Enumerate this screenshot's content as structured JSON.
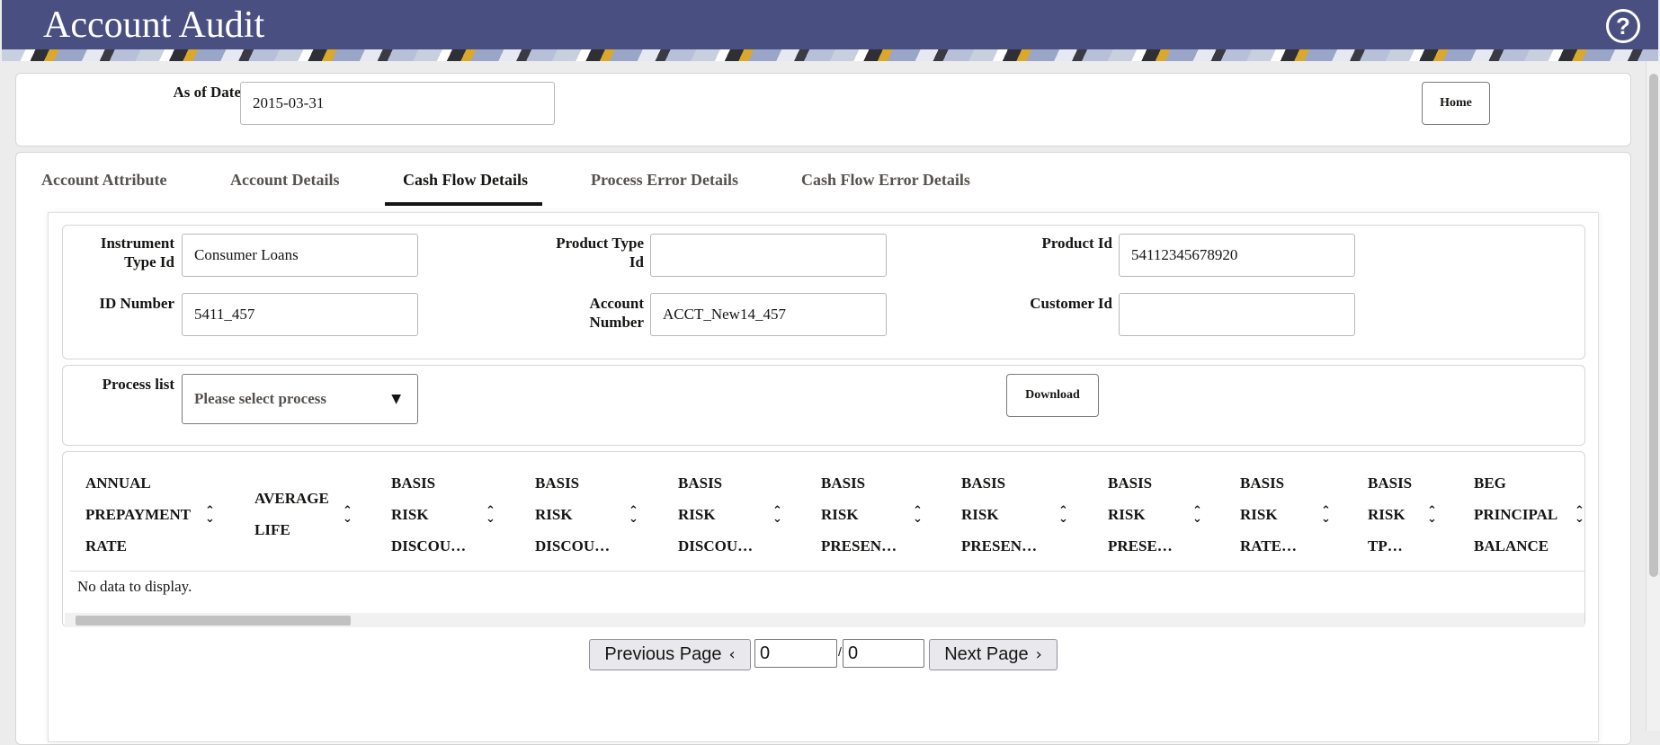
{
  "app": {
    "title": "Account Audit",
    "help_icon": "help-circle-icon"
  },
  "filter": {
    "as_of_date_label": "As of Date",
    "as_of_date_value": "2015-03-31",
    "home_label": "Home"
  },
  "tabs": [
    {
      "label": "Account Attribute",
      "active": false
    },
    {
      "label": "Account Details",
      "active": false
    },
    {
      "label": "Cash Flow Details",
      "active": true
    },
    {
      "label": "Process Error Details",
      "active": false
    },
    {
      "label": "Cash Flow Error Details",
      "active": false
    }
  ],
  "details": {
    "instrument_type_id": {
      "label_line1": "Instrument",
      "label_line2": "Type Id",
      "value": "Consumer Loans"
    },
    "product_type_id": {
      "label_line1": "Product Type",
      "label_line2": "Id",
      "value": ""
    },
    "product_id": {
      "label": "Product Id",
      "value": "54112345678920"
    },
    "id_number": {
      "label": "ID Number",
      "value": "5411_457"
    },
    "account_number": {
      "label_line1": "Account",
      "label_line2": "Number",
      "value": "ACCT_New14_457"
    },
    "customer_id": {
      "label": "Customer Id",
      "value": ""
    }
  },
  "process": {
    "label": "Process list",
    "placeholder": "Please select process",
    "download_label": "Download"
  },
  "table": {
    "columns": [
      {
        "lines": [
          "ANNUAL",
          "PREPAYMENT",
          "RATE"
        ]
      },
      {
        "lines": [
          "AVERAGE",
          "LIFE"
        ]
      },
      {
        "lines": [
          "BASIS",
          "RISK",
          "DISCOU…"
        ]
      },
      {
        "lines": [
          "BASIS",
          "RISK",
          "DISCOU…"
        ]
      },
      {
        "lines": [
          "BASIS",
          "RISK",
          "DISCOU…"
        ]
      },
      {
        "lines": [
          "BASIS",
          "RISK",
          "PRESEN…"
        ]
      },
      {
        "lines": [
          "BASIS",
          "RISK",
          "PRESEN…"
        ]
      },
      {
        "lines": [
          "BASIS",
          "RISK",
          "PRESE…"
        ]
      },
      {
        "lines": [
          "BASIS",
          "RISK",
          "RATE…"
        ]
      },
      {
        "lines": [
          "BASIS",
          "RISK",
          "TP…"
        ]
      },
      {
        "lines": [
          "BEG",
          "PRINCIPAL",
          "BALANCE"
        ]
      }
    ],
    "empty_message": "No data to display."
  },
  "pager": {
    "prev_label": "Previous Page",
    "next_label": "Next Page",
    "current_page": "0",
    "separator": "/",
    "total_pages": "0"
  }
}
